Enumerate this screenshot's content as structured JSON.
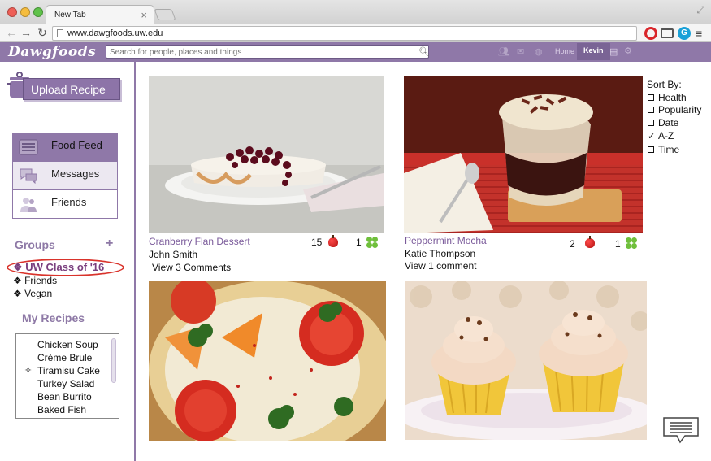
{
  "browser": {
    "tab_title": "New Tab",
    "tab_close": "×",
    "url": "www.dawgfoods.uw.edu",
    "ext_g": "G"
  },
  "header": {
    "logo": "Dawgfoods",
    "search_placeholder": "Search for people, places and things",
    "home_label": "Home",
    "user_label": "Kevin"
  },
  "sidebar": {
    "upload_label": "Upload Recipe",
    "menu": [
      {
        "label": "Food Feed",
        "icon": "food-feed-icon"
      },
      {
        "label": "Messages",
        "icon": "messages-icon"
      },
      {
        "label": "Friends",
        "icon": "friends-icon"
      }
    ],
    "groups_title": "Groups",
    "groups_add": "+",
    "groups": [
      {
        "label": "❖ UW Class of '16",
        "active": true
      },
      {
        "label": "❖ Friends"
      },
      {
        "label": "❖ Vegan"
      }
    ],
    "recipes_title": "My Recipes",
    "recipes": [
      {
        "label": "Chicken Soup"
      },
      {
        "label": "Crème Brule"
      },
      {
        "label": "Tiramisu Cake",
        "marker": "✧"
      },
      {
        "label": "Turkey Salad"
      },
      {
        "label": "Bean Burrito"
      },
      {
        "label": "Baked Fish"
      }
    ]
  },
  "feed": {
    "cards": [
      {
        "title": "Cranberry Flan Dessert",
        "author": "John Smith",
        "comments": "View 3 Comments",
        "apples": "15",
        "clovers": "1"
      },
      {
        "title": "Peppermint Mocha",
        "author": "Katie Thompson",
        "comments": "View 1 comment",
        "apples": "2",
        "clovers": "1"
      },
      {
        "title": "",
        "author": "",
        "comments": ""
      },
      {
        "title": "",
        "author": "",
        "comments": ""
      }
    ]
  },
  "sort": {
    "title": "Sort By:",
    "options": [
      {
        "label": "Health",
        "checked": false
      },
      {
        "label": "Popularity",
        "checked": false
      },
      {
        "label": "Date",
        "checked": false
      },
      {
        "label": "A-Z",
        "checked": true
      },
      {
        "label": "Time",
        "checked": false
      }
    ],
    "check_glyph": "✓"
  },
  "colors": {
    "brand_purple": "#8f78a8",
    "link_purple": "#7a5a9a",
    "highlight_red": "#d9332b"
  }
}
